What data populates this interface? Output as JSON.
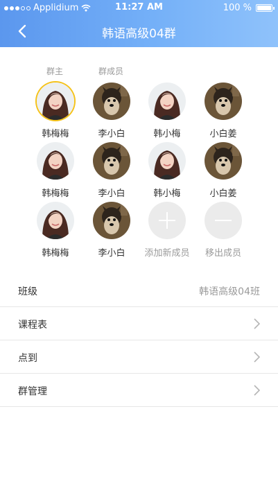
{
  "status_bar": {
    "carrier": "Applidium",
    "time": "11:27 AM",
    "battery": "100 %"
  },
  "nav": {
    "title": "韩语高级04群"
  },
  "roles": {
    "owner": "群主",
    "members": "群成员"
  },
  "members": [
    {
      "name": "韩梅梅",
      "avatar": "woman-avatar",
      "owner": true
    },
    {
      "name": "李小白",
      "avatar": "dog-avatar"
    },
    {
      "name": "韩小梅",
      "avatar": "woman-avatar"
    },
    {
      "name": "小白姜",
      "avatar": "dog-avatar"
    },
    {
      "name": "韩梅梅",
      "avatar": "woman-avatar"
    },
    {
      "name": "李小白",
      "avatar": "dog-avatar"
    },
    {
      "name": "韩小梅",
      "avatar": "woman-avatar"
    },
    {
      "name": "小白姜",
      "avatar": "dog-avatar"
    },
    {
      "name": "韩梅梅",
      "avatar": "woman-avatar"
    },
    {
      "name": "李小白",
      "avatar": "dog-avatar"
    }
  ],
  "actions": {
    "add_label": "添加新成员",
    "remove_label": "移出成员"
  },
  "settings": {
    "class_label": "班级",
    "class_value": "韩语高级04班",
    "schedule_label": "课程表",
    "checkin_label": "点到",
    "manage_label": "群管理"
  },
  "colors": {
    "header_start": "#5b97ee",
    "header_end": "#8fc2fb",
    "owner_ring": "#f5c218"
  }
}
